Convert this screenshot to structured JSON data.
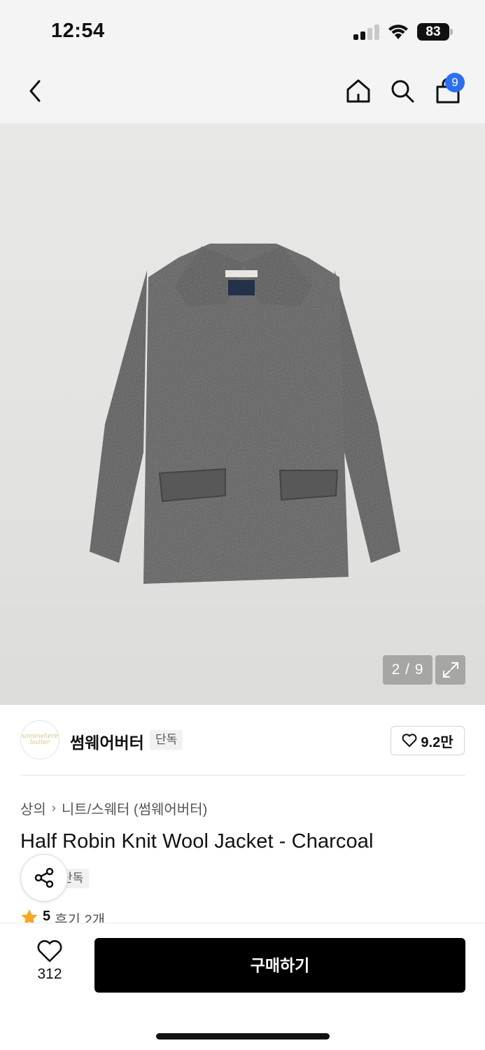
{
  "status_bar": {
    "time": "12:54",
    "battery": "83"
  },
  "nav": {
    "cart_badge": "9"
  },
  "gallery": {
    "pager": "2 / 9"
  },
  "brand": {
    "name": "썸웨어버터",
    "tag": "단독",
    "likes": "9.2만",
    "logo_text_1": "somewhere",
    "logo_text_2": "butter"
  },
  "breadcrumb": {
    "category": "상의",
    "subcategory": "니트/스웨터 (썸웨어버터)"
  },
  "product": {
    "title": "Half Robin Knit Wool Jacket - Charcoal",
    "tag": "단독"
  },
  "rating": {
    "score": "5",
    "reviews": "후기 2개"
  },
  "bottom": {
    "wish_count": "312",
    "buy_label": "구매하기"
  },
  "colors": {
    "accent": "#2b6ef2",
    "star": "#f5a623",
    "buy_button": "#000000",
    "jacket": "#4f4f4f"
  }
}
